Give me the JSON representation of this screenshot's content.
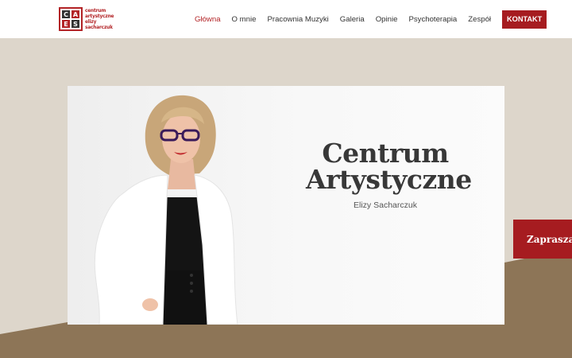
{
  "logo": {
    "mark": "CAES",
    "lines": [
      "centrum",
      "artystyczne",
      "elizy",
      "sacharczuk"
    ]
  },
  "nav": {
    "items": [
      {
        "label": "Główna",
        "active": true
      },
      {
        "label": "O mnie"
      },
      {
        "label": "Pracownia Muzyki"
      },
      {
        "label": "Galeria"
      },
      {
        "label": "Opinie"
      },
      {
        "label": "Psychoterapia"
      },
      {
        "label": "Zespół"
      }
    ],
    "cta_label": "KONTAKT"
  },
  "hero": {
    "title_line1": "Centrum",
    "title_line2": "Artystyczne",
    "subtitle": "Elizy Sacharczuk"
  },
  "side_tab": {
    "label": "Zaprasza na"
  },
  "colors": {
    "accent": "#a61c20",
    "background": "#ddd6cb",
    "band": "#8d7557"
  }
}
